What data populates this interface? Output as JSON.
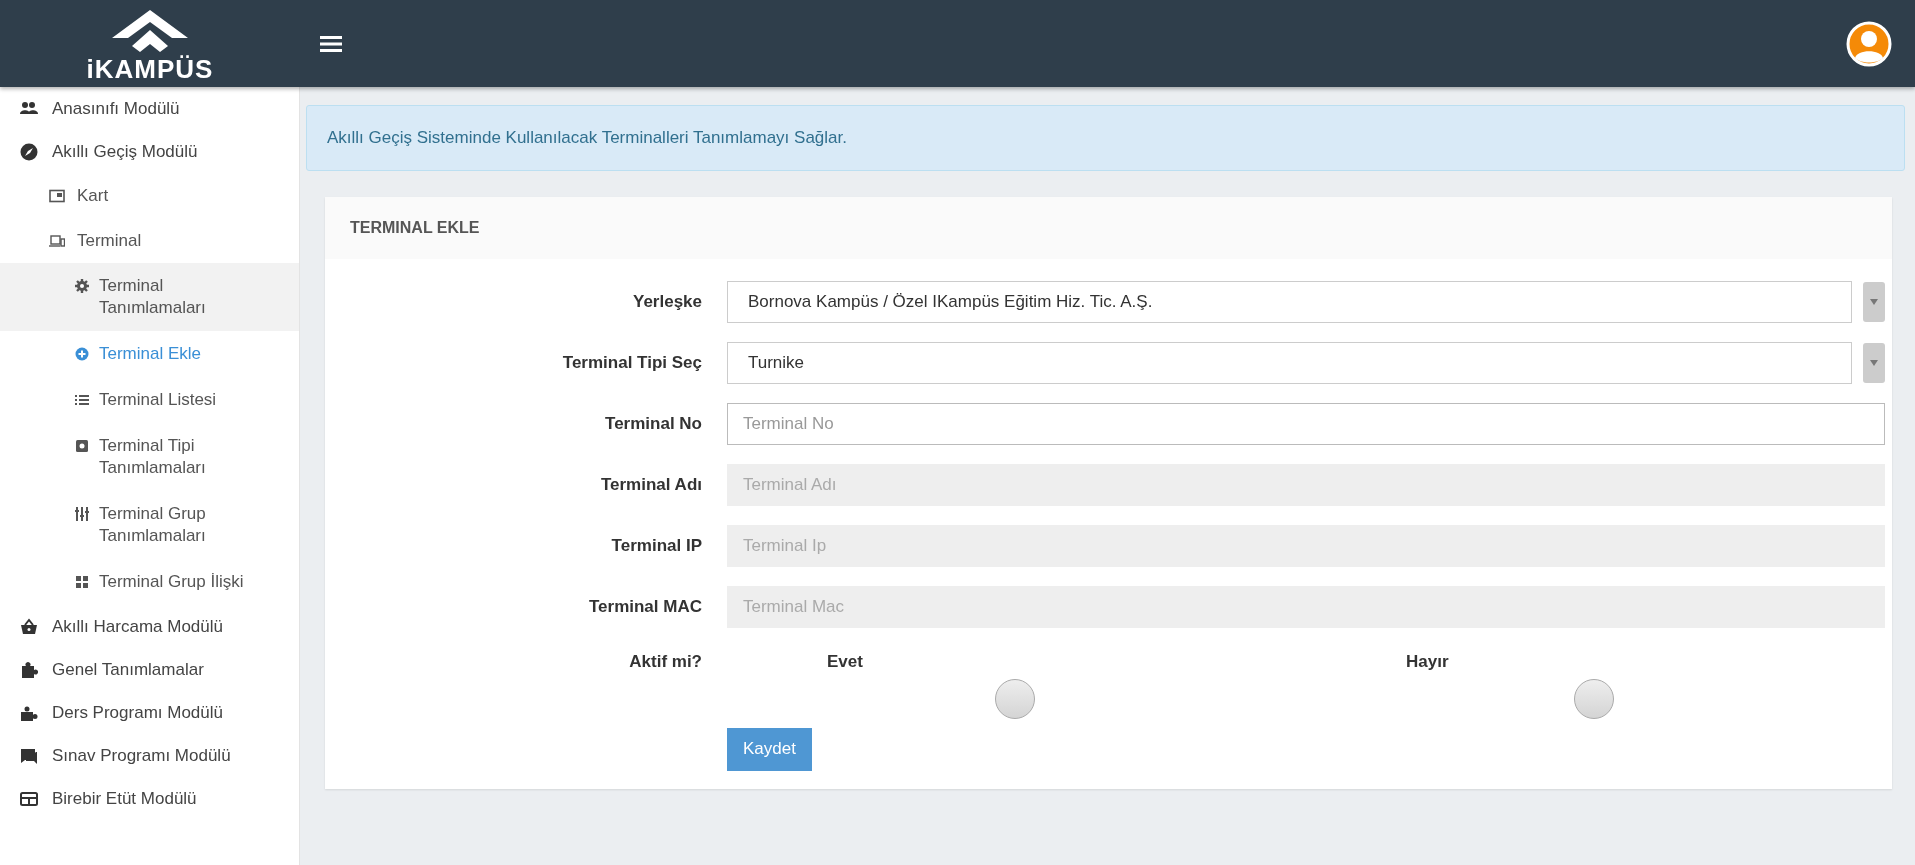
{
  "logo": {
    "text": "iKAMPÜS"
  },
  "sidebar": {
    "items": [
      {
        "label": "Anasınıfı Modülü",
        "selected": false
      },
      {
        "label": "Akıllı Geçiş Modülü",
        "selected": false,
        "children": [
          {
            "label": "Kart",
            "selected": false
          },
          {
            "label": "Terminal",
            "selected": false,
            "children": [
              {
                "label": "Terminal Tanımlamaları",
                "selected": false,
                "highlighted": true
              },
              {
                "label": "Terminal Ekle",
                "selected": true,
                "highlighted": false
              },
              {
                "label": "Terminal Listesi",
                "selected": false,
                "highlighted": false
              },
              {
                "label": "Terminal Tipi Tanımlamaları",
                "selected": false,
                "highlighted": false
              },
              {
                "label": "Terminal Grup Tanımlamaları",
                "selected": false,
                "highlighted": false
              },
              {
                "label": "Terminal Grup İlişki",
                "selected": false,
                "highlighted": false
              }
            ]
          }
        ]
      },
      {
        "label": "Akıllı Harcama Modülü",
        "selected": false
      },
      {
        "label": "Genel Tanımlamalar",
        "selected": false
      },
      {
        "label": "Ders Programı Modülü",
        "selected": false
      },
      {
        "label": "Sınav Programı Modülü",
        "selected": false
      },
      {
        "label": "Birebir Etüt Modülü",
        "selected": false
      }
    ]
  },
  "info": {
    "text": "Akıllı Geçiş Sisteminde Kullanılacak Terminalleri Tanımlamayı Sağlar."
  },
  "card": {
    "title": "TERMINAL EKLE",
    "fields": [
      {
        "kind": "select",
        "label": "Yerleşke",
        "value": "Bornova Kampüs / Özel IKampüs Eğitim Hiz. Tic. A.Ş."
      },
      {
        "kind": "select",
        "label": "Terminal Tipi Seç",
        "value": "Turnike"
      },
      {
        "kind": "input",
        "label": "Terminal No",
        "placeholder": "Terminal No",
        "disabled": false
      },
      {
        "kind": "input",
        "label": "Terminal Adı",
        "placeholder": "Terminal Adı",
        "disabled": true
      },
      {
        "kind": "input",
        "label": "Terminal IP",
        "placeholder": "Terminal Ip",
        "disabled": true
      },
      {
        "kind": "input",
        "label": "Terminal MAC",
        "placeholder": "Terminal Mac",
        "disabled": true
      }
    ],
    "active": {
      "label": "Aktif mi?",
      "options": [
        {
          "label": "Evet",
          "selected": false
        },
        {
          "label": "Hayır",
          "selected": false
        }
      ]
    },
    "save_button": "Kaydet"
  }
}
